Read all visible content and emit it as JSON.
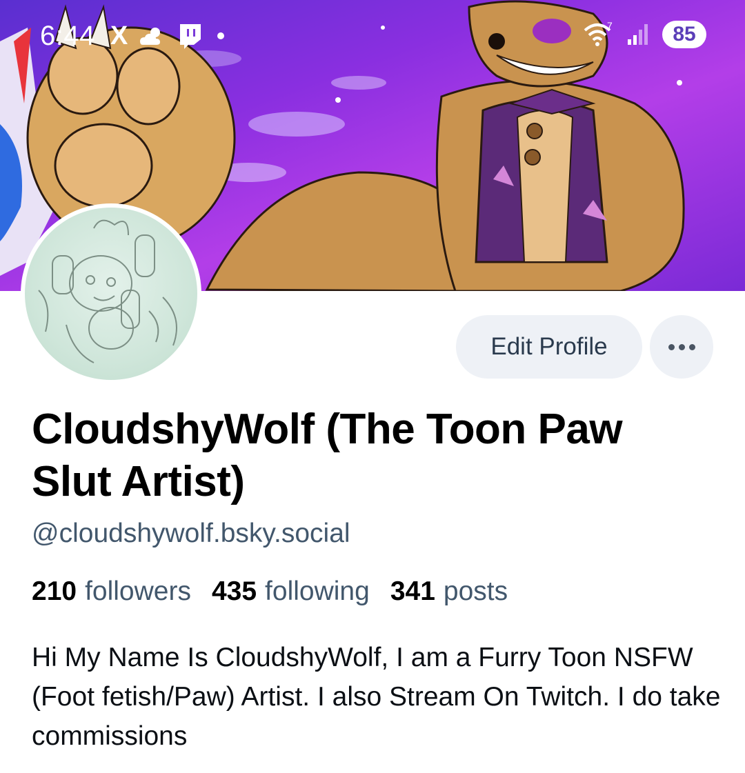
{
  "status_bar": {
    "time": "6:44",
    "x_icon": "X",
    "battery": "85",
    "network_badge": "7",
    "icons": [
      "x-logo-icon",
      "weather-icon",
      "twitch-icon",
      "notification-dot-icon",
      "wifi-icon",
      "signal-icon",
      "battery-icon"
    ]
  },
  "profile": {
    "display_name": "CloudshyWolf (The Toon Paw Slut Artist)",
    "handle": "@cloudshywolf.bsky.social",
    "stats": {
      "followers_count": "210",
      "followers_label": "followers",
      "following_count": "435",
      "following_label": "following",
      "posts_count": "341",
      "posts_label": "posts"
    },
    "bio": "Hi My Name Is CloudshyWolf, I am a Furry Toon NSFW (Foot fetish/Paw) Artist. I also Stream On Twitch. I do take commissions"
  },
  "actions": {
    "edit_profile_label": "Edit Profile",
    "more_icon": "more-options-icon"
  },
  "colors": {
    "banner_purple": "#8a2fe0",
    "button_bg": "#eef1f6",
    "secondary_text": "#42576c"
  }
}
